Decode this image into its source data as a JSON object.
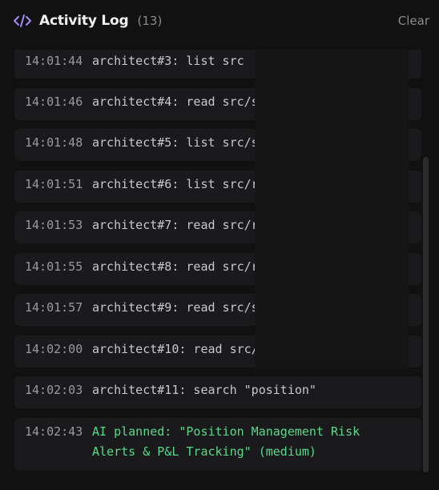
{
  "header": {
    "title": "Activity Log",
    "count": "13",
    "clear_label": "Clear",
    "icon": "code-icon",
    "accent": "#a78bfa"
  },
  "entries": [
    {
      "time": "14:01:44",
      "message": "architect#3: list src"
    },
    {
      "time": "14:01:46",
      "message": "architect#4: read src/s"
    },
    {
      "time": "14:01:48",
      "message": "architect#5: list src/s"
    },
    {
      "time": "14:01:51",
      "message": "architect#6: list src/r"
    },
    {
      "time": "14:01:53",
      "message": "architect#7: read src/r"
    },
    {
      "time": "14:01:55",
      "message": "architect#8: read src/r"
    },
    {
      "time": "14:01:57",
      "message": "architect#9: read src/s"
    },
    {
      "time": "14:02:00",
      "message": "architect#10: read src/"
    },
    {
      "time": "14:02:03",
      "message": "architect#11: search \"position\""
    },
    {
      "time": "14:02:43",
      "message": "AI planned: \"Position Management Risk\nAlerts & P&L Tracking\" (medium)"
    }
  ],
  "colors": {
    "background": "#111112",
    "entry_bg": "#1a1a1c",
    "ai_message": "#59d98a"
  }
}
